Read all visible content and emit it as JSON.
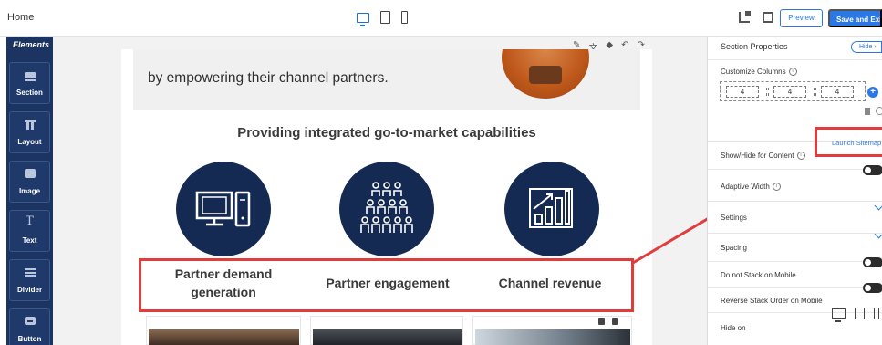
{
  "topbar": {
    "home_label": "Home",
    "preview_label": "Preview",
    "save_exit_label": "Save and Exit"
  },
  "sidebar": {
    "title": "Elements",
    "items": [
      {
        "label": "Section",
        "icon": "section-icon"
      },
      {
        "label": "Layout",
        "icon": "layout-icon"
      },
      {
        "label": "Image",
        "icon": "image-icon"
      },
      {
        "label": "Text",
        "icon": "text-icon"
      },
      {
        "label": "Divider",
        "icon": "divider-icon"
      },
      {
        "label": "Button",
        "icon": "button-icon"
      }
    ]
  },
  "canvas": {
    "hero_text": "by empowering their channel partners.",
    "section_title": "Providing integrated go-to-market capabilities",
    "capabilities": [
      {
        "line1": "Partner demand",
        "line2": "generation",
        "icon": "computer-icon"
      },
      {
        "line1": "Partner engagement",
        "line2": "",
        "icon": "people-group-icon"
      },
      {
        "line1": "Channel revenue",
        "line2": "",
        "icon": "growth-chart-icon"
      }
    ],
    "text_icon_glyph": "T"
  },
  "panel": {
    "title": "Section Properties",
    "hide_label": "Hide",
    "customize_columns_label": "Customize Columns",
    "columns": [
      "4",
      "4",
      "4"
    ],
    "show_hide_label": "Show/Hide for Content",
    "launch_sitemap_label": "Launch Sitemap",
    "adaptive_width_label": "Adaptive Width",
    "settings_label": "Settings",
    "spacing_label": "Spacing",
    "no_stack_label": "Do not Stack on Mobile",
    "reverse_stack_label": "Reverse Stack Order on Mobile",
    "hide_on_label": "Hide on"
  },
  "colors": {
    "sidebar_bg": "#1c3461",
    "accent": "#2b78e4",
    "circle_bg": "#152a52",
    "highlight": "#e23b3b"
  }
}
